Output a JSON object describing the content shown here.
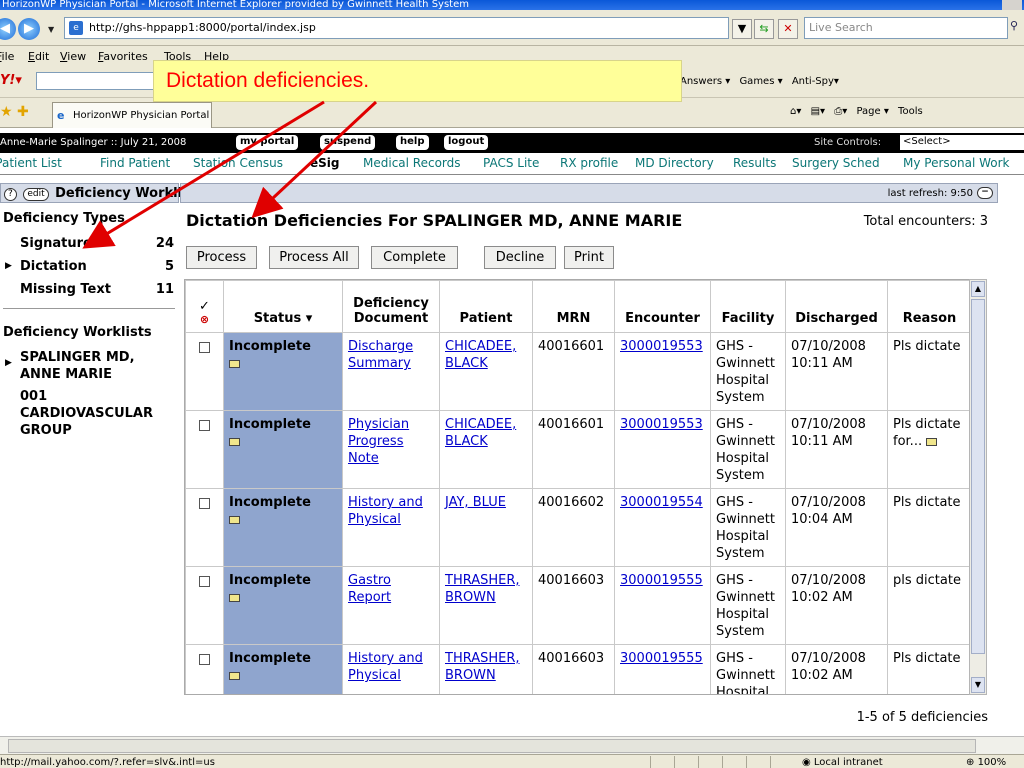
{
  "browser": {
    "window_title": "HorizonWP Physician Portal - Microsoft Internet Explorer provided by Gwinnett Health System",
    "address": "http://ghs-hppapp1:8000/portal/index.jsp",
    "search_placeholder": "Live Search",
    "menu": [
      "File",
      "Edit",
      "View",
      "Favorites",
      "Tools",
      "Help"
    ],
    "toolbar_links": [
      "Answers ▾",
      "Games ▾",
      "Anti-Spy▾"
    ],
    "tab_title": "HorizonWP Physician Portal",
    "command_bar": [
      "Page ▾",
      "Tools"
    ],
    "status_url": "http://mail.yahoo.com/?.refer=slv&.intl=us",
    "zone": "Local intranet",
    "zoom": "100%"
  },
  "portal": {
    "user_info": "Anne-Marie Spalinger :: July 21, 2008",
    "buttons": [
      "my portal",
      "suspend",
      "help",
      "logout"
    ],
    "site_controls_label": "Site Controls:",
    "site_controls_value": "<Select>",
    "nav_tabs": [
      "My Patient List",
      "Find Patient",
      "Station Census",
      "eSig",
      "Medical Records",
      "PACS Lite",
      "RX profile",
      "MD Directory",
      "Results",
      "Surgery Sched",
      "My Personal Work"
    ],
    "active_tab": "eSig"
  },
  "sidebar": {
    "header": "Deficiency Worklist",
    "help_icon": "?",
    "edit_label": "edit",
    "types_title": "Deficiency Types",
    "types": [
      {
        "label": "Signature",
        "count": "24"
      },
      {
        "label": "Dictation",
        "count": "5"
      },
      {
        "label": "Missing Text",
        "count": "11"
      }
    ],
    "worklists_title": "Deficiency Worklists",
    "worklist_owner": "SPALINGER MD, ANNE MARIE",
    "worklist_group": "001 CARDIOVASCULAR GROUP"
  },
  "main": {
    "last_refresh": "last refresh: 9:50",
    "title": "Dictation Deficiencies For SPALINGER MD, ANNE MARIE",
    "total": "Total encounters: 3",
    "actions": [
      "Process",
      "Process All",
      "Complete",
      "Decline",
      "Print"
    ],
    "columns": [
      "Status ▾",
      "Deficiency Document",
      "Patient",
      "MRN",
      "Encounter",
      "Facility",
      "Discharged",
      "Reason"
    ],
    "rows": [
      {
        "status": "Incomplete",
        "document": "Discharge Summary",
        "patient": "CHICADEE, BLACK",
        "mrn": "40016601",
        "encounter": "3000019553",
        "facility": "GHS - Gwinnett Hospital System",
        "discharged": "07/10/2008 10:11 AM",
        "reason": "Pls dictate"
      },
      {
        "status": "Incomplete",
        "document": "Physician Progress Note",
        "patient": "CHICADEE, BLACK",
        "mrn": "40016601",
        "encounter": "3000019553",
        "facility": "GHS - Gwinnett Hospital System",
        "discharged": "07/10/2008 10:11 AM",
        "reason": "Pls dictate for..."
      },
      {
        "status": "Incomplete",
        "document": "History and Physical",
        "patient": "JAY, BLUE",
        "mrn": "40016602",
        "encounter": "3000019554",
        "facility": "GHS - Gwinnett Hospital System",
        "discharged": "07/10/2008 10:04 AM",
        "reason": "Pls dictate"
      },
      {
        "status": "Incomplete",
        "document": "Gastro Report",
        "patient": "THRASHER, BROWN",
        "mrn": "40016603",
        "encounter": "3000019555",
        "facility": "GHS - Gwinnett Hospital System",
        "discharged": "07/10/2008 10:02 AM",
        "reason": "pls dictate"
      },
      {
        "status": "Incomplete",
        "document": "History and Physical",
        "patient": "THRASHER, BROWN",
        "mrn": "40016603",
        "encounter": "3000019555",
        "facility": "GHS - Gwinnett Hospital System",
        "discharged": "07/10/2008 10:02 AM",
        "reason": "Pls dictate"
      }
    ],
    "pager": "1-5 of 5 deficiencies"
  },
  "annotation": {
    "callout": "Dictation deficiencies.",
    "color": "#ff0000"
  }
}
